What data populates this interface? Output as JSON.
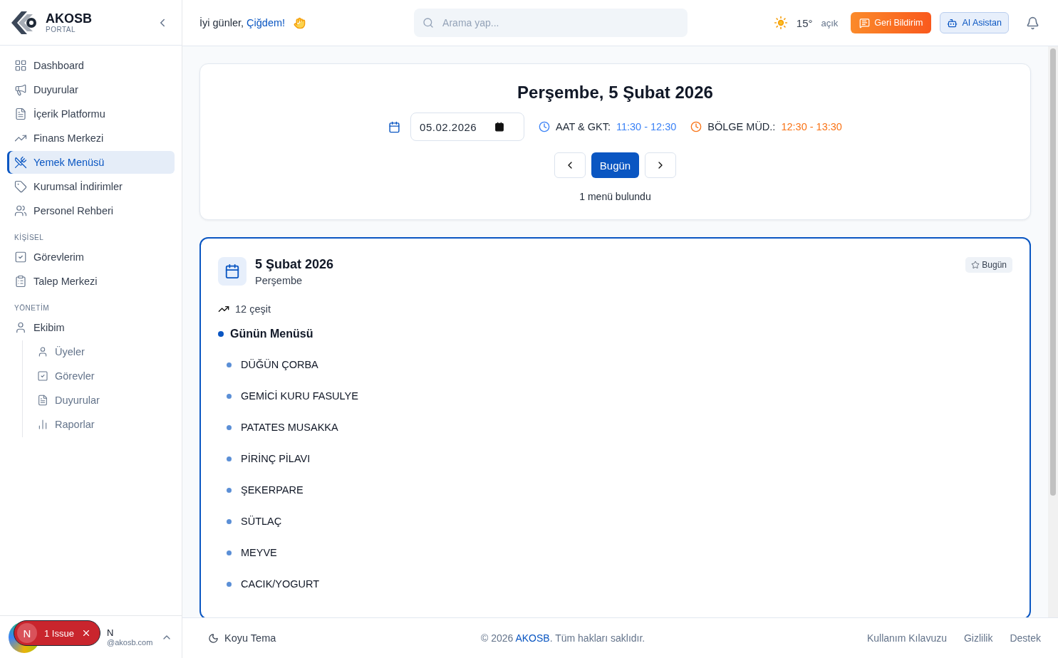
{
  "brand": {
    "name": "AKOSB",
    "subtitle": "PORTAL"
  },
  "sidebar": {
    "sections": [
      {
        "items": [
          {
            "label": "Dashboard",
            "selected": false
          },
          {
            "label": "Duyurular",
            "selected": false
          },
          {
            "label": "İçerik Platformu",
            "selected": false
          },
          {
            "label": "Finans Merkezi",
            "selected": false
          },
          {
            "label": "Yemek Menüsü",
            "selected": true
          },
          {
            "label": "Kurumsal İndirimler",
            "selected": false
          },
          {
            "label": "Personel Rehberi",
            "selected": false
          }
        ]
      },
      {
        "heading": "KİŞİSEL",
        "items": [
          {
            "label": "Görevlerim",
            "selected": false
          },
          {
            "label": "Talep Merkezi",
            "selected": false
          }
        ]
      },
      {
        "heading": "YÖNETİM",
        "items": [
          {
            "label": "Ekibim",
            "selected": false,
            "children": [
              {
                "label": "Üyeler",
                "selected": false
              },
              {
                "label": "Görevler",
                "selected": false
              },
              {
                "label": "Duyurular",
                "selected": false
              },
              {
                "label": "Raporlar",
                "selected": false
              }
            ]
          }
        ]
      }
    ],
    "user": {
      "name": "N",
      "email": "@akosb.com"
    }
  },
  "issue_badge": {
    "letter": "N",
    "label": "1 Issue"
  },
  "header": {
    "greeting": "İyi günler,",
    "user_name": "Çiğdem!",
    "search": {
      "placeholder": "Arama yap..."
    },
    "weather": {
      "temperature": "15°",
      "condition": "açık"
    },
    "feedback_button": "Geri Bildirim",
    "assistant_button": "AI Asistan"
  },
  "day_panel": {
    "title": "Perşembe, 5 Şubat 2026",
    "date_value": "05.02.2026",
    "shifts": [
      {
        "label": "AAT & GKT:",
        "time": "11:30 - 12:30",
        "color": "#3b82f6"
      },
      {
        "label": "BÖLGE MÜD.:",
        "time": "12:30 - 13:30",
        "color": "#f97316"
      }
    ],
    "today_button": "Bugün",
    "result": "1 menü bulundu"
  },
  "menu_card": {
    "date": "5 Şubat 2026",
    "weekday": "Perşembe",
    "badge": "Bugün",
    "count": "12 çeşit",
    "section": "Günün Menüsü",
    "items": [
      "DÜĞÜN ÇORBA",
      "GEMİCİ KURU FASULYE",
      "PATATES MUSAKKA",
      "PİRİNÇ PİLAVI",
      "ŞEKERPARE",
      "SÜTLAÇ",
      "MEYVE",
      "CACIK/YOGURT"
    ]
  },
  "footer": {
    "theme_toggle": "Koyu Tema",
    "copyright_prefix": "© 2026",
    "copyright_brand": "AKOSB",
    "copyright_suffix": ". Tüm hakları saklıdır.",
    "links": [
      "Kullanım Kılavuzu",
      "Gizlilik",
      "Destek"
    ]
  }
}
